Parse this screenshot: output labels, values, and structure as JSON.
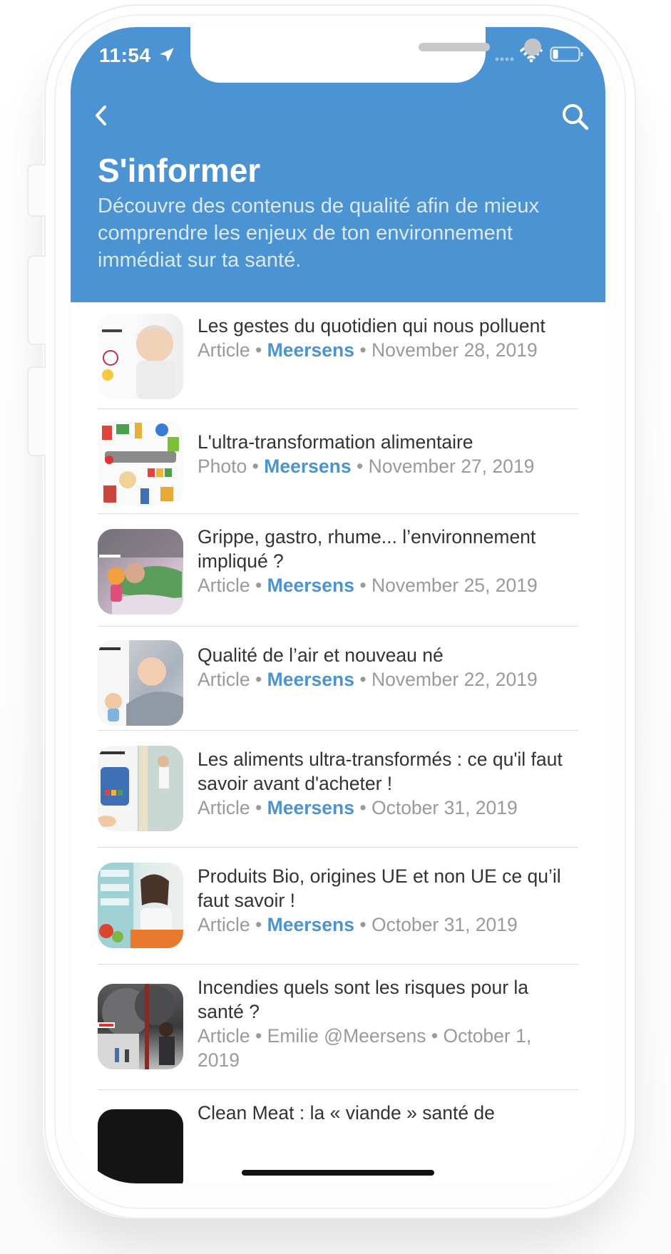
{
  "status_bar": {
    "time": "11:54"
  },
  "header": {
    "title": "S'informer",
    "subtitle": "Découvre des contenus de qualité afin de mieux comprendre les enjeux de ton environnement immédiat sur ta santé."
  },
  "separator": "•",
  "articles": [
    {
      "title": "Les gestes du quotidien qui nous polluent",
      "type": "Article",
      "author": "Meersens",
      "date": "November 28, 2019"
    },
    {
      "title": "L'ultra-transformation alimentaire",
      "type": "Photo",
      "author": "Meersens",
      "date": "November 27, 2019"
    },
    {
      "title": "Grippe, gastro, rhume... l’environnement impliqué ?",
      "type": "Article",
      "author": "Meersens",
      "date": "November 25, 2019"
    },
    {
      "title": "Qualité de l’air et nouveau né",
      "type": "Article",
      "author": "Meersens",
      "date": "November 22, 2019"
    },
    {
      "title": "Les aliments ultra-transformés : ce qu'il faut savoir avant d'acheter !",
      "type": "Article",
      "author": "Meersens",
      "date": "October 31, 2019"
    },
    {
      "title": "Produits Bio, origines UE et non UE ce qu’il faut savoir !",
      "type": "Article",
      "author": "Meersens",
      "date": "October 31, 2019"
    },
    {
      "title": "Incendies quels sont les risques pour la santé ?",
      "type": "Article",
      "author": "Emilie @Meersens",
      "date": "October 1, 2019"
    },
    {
      "title": "Clean Meat : la « viande » santé de",
      "type": "",
      "author": "",
      "date": ""
    }
  ],
  "colors": {
    "accent": "#4b93d2",
    "header_bg": "#4b93d2",
    "meta_gray": "#9a9a9a",
    "title_text": "#333333"
  },
  "icons": {
    "back": "chevron-left-icon",
    "search": "search-icon",
    "location": "location-arrow-icon",
    "signal": "cell-signal-icon",
    "wifi": "wifi-icon",
    "battery": "battery-icon"
  }
}
